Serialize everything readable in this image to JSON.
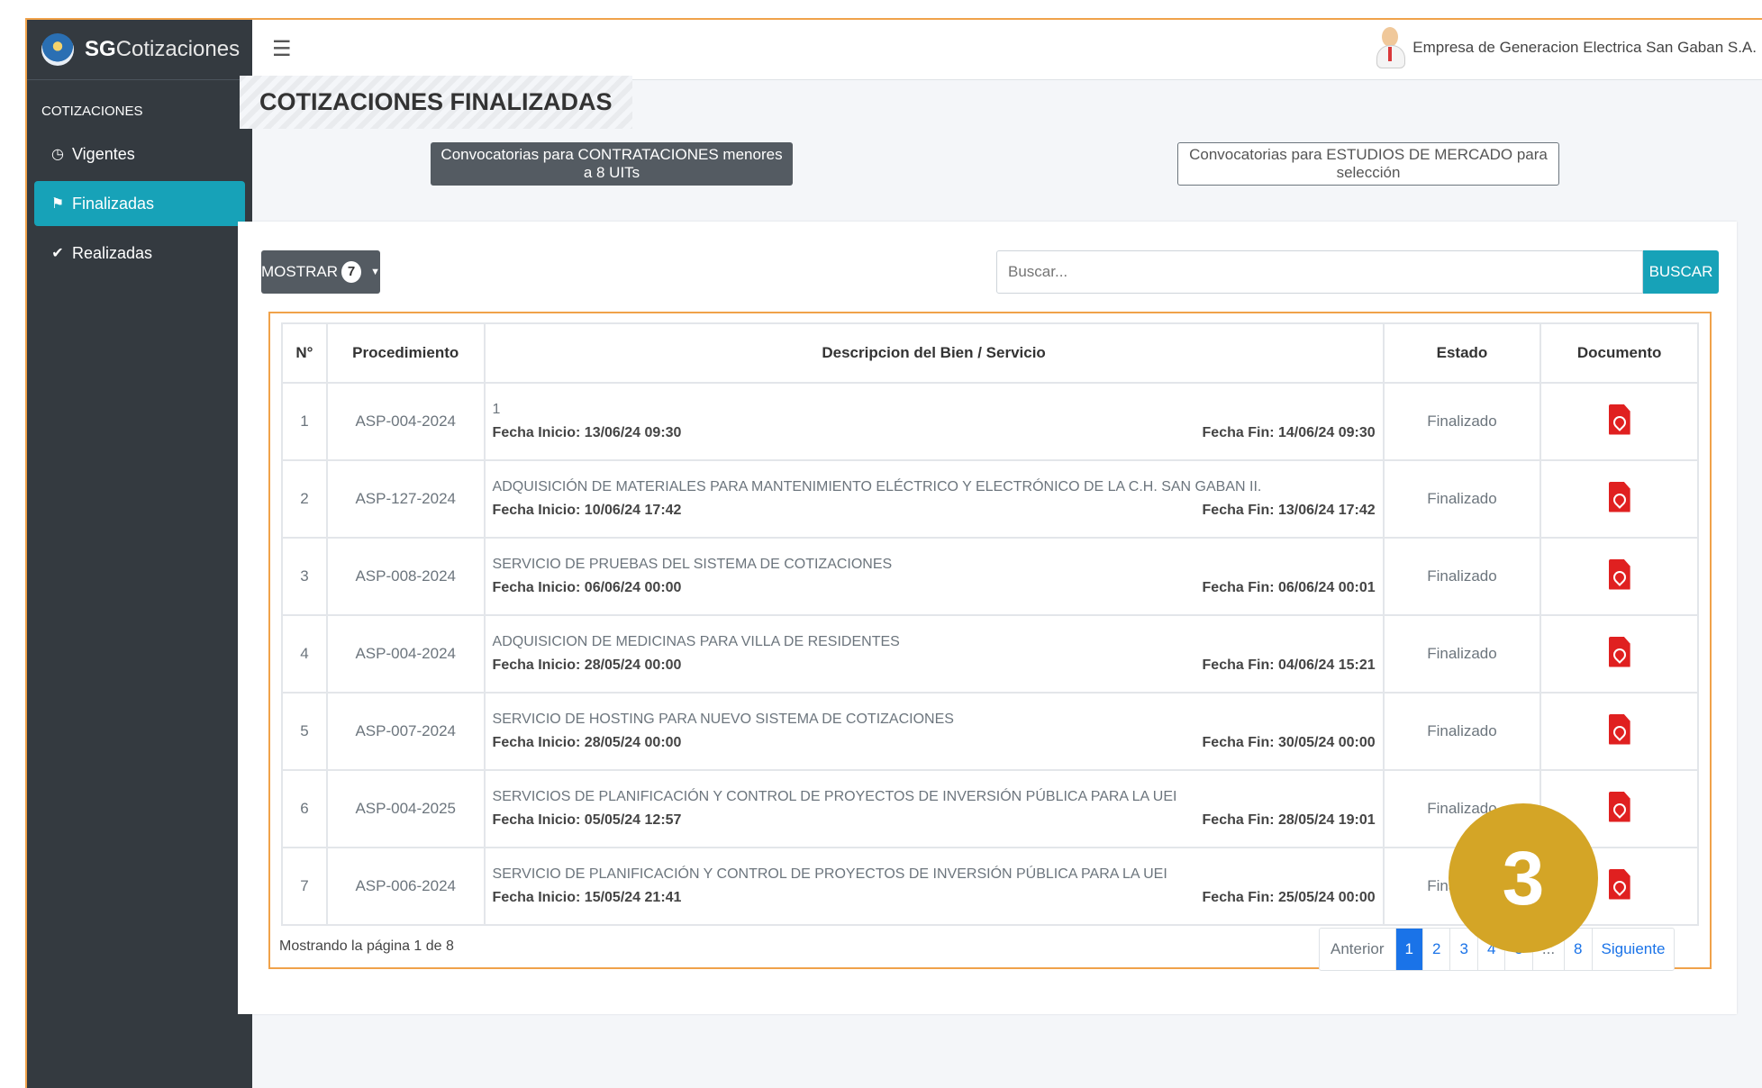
{
  "app": {
    "brand_bold": "SG",
    "brand_rest": "Cotizaciones"
  },
  "sidebar": {
    "section": "COTIZACIONES",
    "items": [
      {
        "label": "Vigentes",
        "icon": "clock-icon"
      },
      {
        "label": "Finalizadas",
        "icon": "flag-icon",
        "active": true
      },
      {
        "label": "Realizadas",
        "icon": "check-icon"
      }
    ]
  },
  "topbar": {
    "user_name": "Empresa de Generacion Electrica San Gaban S.A."
  },
  "page": {
    "title": "COTIZACIONES FINALIZADAS",
    "btn_contrataciones": "Convocatorias para CONTRATACIONES menores a 8 UITs",
    "btn_estudios": "Convocatorias para ESTUDIOS DE MERCADO para selección"
  },
  "controls": {
    "mostrar_label": "MOSTRAR",
    "mostrar_value": "7",
    "search_placeholder": "Buscar...",
    "search_button": "BUSCAR"
  },
  "table": {
    "headers": [
      "N°",
      "Procedimiento",
      "Descripcion del Bien / Servicio",
      "Estado",
      "Documento"
    ],
    "rows": [
      {
        "n": "1",
        "proc": "ASP-004-2024",
        "desc": "1",
        "inicio": "Fecha Inicio: 13/06/24 09:30",
        "fin": "Fecha Fin: 14/06/24 09:30",
        "estado": "Finalizado"
      },
      {
        "n": "2",
        "proc": "ASP-127-2024",
        "desc": "ADQUISICIÓN DE MATERIALES PARA MANTENIMIENTO ELÉCTRICO Y ELECTRÓNICO DE LA C.H. SAN GABAN II.",
        "inicio": "Fecha Inicio: 10/06/24 17:42",
        "fin": "Fecha Fin: 13/06/24 17:42",
        "estado": "Finalizado"
      },
      {
        "n": "3",
        "proc": "ASP-008-2024",
        "desc": "SERVICIO DE PRUEBAS DEL SISTEMA DE COTIZACIONES",
        "inicio": "Fecha Inicio: 06/06/24 00:00",
        "fin": "Fecha Fin: 06/06/24 00:01",
        "estado": "Finalizado"
      },
      {
        "n": "4",
        "proc": "ASP-004-2024",
        "desc": "ADQUISICION DE MEDICINAS PARA VILLA DE RESIDENTES",
        "inicio": "Fecha Inicio: 28/05/24 00:00",
        "fin": "Fecha Fin: 04/06/24 15:21",
        "estado": "Finalizado"
      },
      {
        "n": "5",
        "proc": "ASP-007-2024",
        "desc": "SERVICIO DE HOSTING PARA NUEVO SISTEMA DE COTIZACIONES",
        "inicio": "Fecha Inicio: 28/05/24 00:00",
        "fin": "Fecha Fin: 30/05/24 00:00",
        "estado": "Finalizado"
      },
      {
        "n": "6",
        "proc": "ASP-004-2025",
        "desc": "SERVICIOS DE PLANIFICACIÓN Y CONTROL DE PROYECTOS DE INVERSIÓN PÚBLICA PARA LA UEI",
        "inicio": "Fecha Inicio: 05/05/24 12:57",
        "fin": "Fecha Fin: 28/05/24 19:01",
        "estado": "Finalizado"
      },
      {
        "n": "7",
        "proc": "ASP-006-2024",
        "desc": "SERVICIO DE PLANIFICACIÓN Y CONTROL DE PROYECTOS DE INVERSIÓN PÚBLICA PARA LA UEI",
        "inicio": "Fecha Inicio: 15/05/24 21:41",
        "fin": "Fecha Fin: 25/05/24 00:00",
        "estado": "Finalizado"
      }
    ]
  },
  "footer": {
    "info": "Mostrando la página 1 de 8",
    "pagination": [
      "Anterior",
      "1",
      "2",
      "3",
      "4",
      "5",
      "...",
      "8",
      "Siguiente"
    ],
    "active_page": "1"
  },
  "overlay": {
    "step_number": "3"
  },
  "colors": {
    "sidebar": "#343a40",
    "accent": "#17a2b8",
    "pdf": "#e02020",
    "step": "#d4a526",
    "highlight": "#f0a24a"
  }
}
